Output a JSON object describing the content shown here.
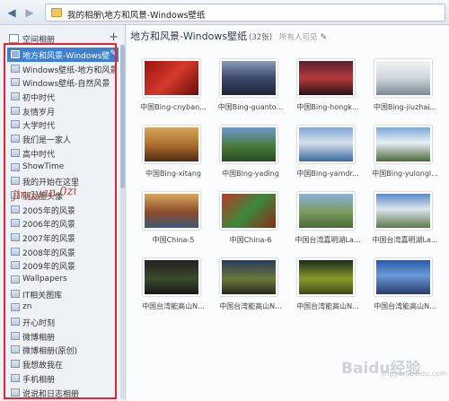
{
  "toolbar": {
    "back_icon": "back-arrow-icon",
    "forward_icon": "forward-icon",
    "address": "我的相册\\地方和风景-Windows壁纸"
  },
  "sidebar": {
    "header": "空间相册",
    "add_icon": "plus-icon",
    "items": [
      {
        "label": "地方和风景-Windows壁",
        "selected": true
      },
      {
        "label": "Windows壁纸-地方和风景"
      },
      {
        "label": "Windows壁纸-自然风景"
      },
      {
        "label": "初中时代"
      },
      {
        "label": "友情岁月"
      },
      {
        "label": "大学时代"
      },
      {
        "label": "我们是一家人"
      },
      {
        "label": "高中时代"
      },
      {
        "label": "ShowTime"
      },
      {
        "label": "我的开始在这里"
      },
      {
        "label": "朋友圈头像"
      },
      {
        "label": "2005年的风景"
      },
      {
        "label": "2006年的风景"
      },
      {
        "label": "2007年的风景"
      },
      {
        "label": "2008年的风景"
      },
      {
        "label": "2009年的风景"
      },
      {
        "label": "Wallpapers"
      },
      {
        "label": "IT相关图库"
      },
      {
        "label": "zn"
      },
      {
        "label": "开心时刻"
      },
      {
        "label": "微博相册"
      },
      {
        "label": "微博相册(原创)"
      },
      {
        "label": "我想故我在"
      },
      {
        "label": "手机相册"
      },
      {
        "label": "说说和日志相册"
      }
    ],
    "watermark": "jingyan.0zi"
  },
  "content": {
    "title": "地方和风景-Windows壁纸",
    "count": "(32张)",
    "visibility": "所有人可见",
    "edit_icon": "pencil-icon",
    "photos": [
      {
        "caption": "中国Bing-cnyban..."
      },
      {
        "caption": "中国Bing-guanto..."
      },
      {
        "caption": "中国Bing-hongk..."
      },
      {
        "caption": "中国Bing-jiuzhai..."
      },
      {
        "caption": "中国Bing-xitang"
      },
      {
        "caption": "中国Bing-yading"
      },
      {
        "caption": "中国Bing-yamdr..."
      },
      {
        "caption": "中国Bing-yulongl..."
      },
      {
        "caption": "中国China-5"
      },
      {
        "caption": "中国China-6"
      },
      {
        "caption": "中国台湾嘉明湖La..."
      },
      {
        "caption": "中国台湾嘉明湖La..."
      },
      {
        "caption": "中国台湾能高山N..."
      },
      {
        "caption": "中国台湾能高山N..."
      },
      {
        "caption": "中国台湾能高山N..."
      },
      {
        "caption": "中国台湾能高山N..."
      }
    ]
  },
  "watermark": {
    "logo": "Baidu经验",
    "url": "jingyan.baidu.com"
  },
  "colors": {
    "selection": "#3d7fd1",
    "highlight_frame": "#e0262e"
  }
}
